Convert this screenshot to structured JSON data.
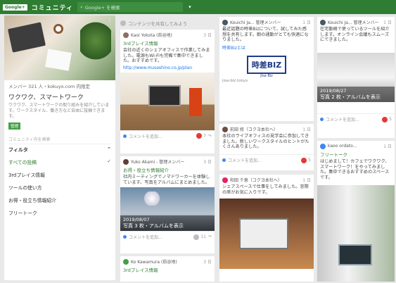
{
  "topbar": {
    "logo": "Google+",
    "app_title": "コミュニティ",
    "search_placeholder": "Google+ を検索",
    "dropdown": "▾"
  },
  "sidebar": {
    "members": "メンバー 321 人・kokuyo.com 内限定",
    "name": "ワクワク、スマートワーク",
    "desc": "ワクワク、スマートワークの取り組みを紹介しています。ワークスタイル、働き方など自由に投稿できます。",
    "manager_badge": "管理",
    "search_placeholder": "コミュニティ内を検索",
    "filter_label": "フィルタ",
    "nav": [
      {
        "label": "すべての投稿",
        "check": "✓"
      },
      {
        "label": "3rdプレイス情報"
      },
      {
        "label": "ツールの使い方"
      },
      {
        "label": "お得・役立ち情報紹介"
      },
      {
        "label": "フリートーク"
      }
    ]
  },
  "share_prompt": "コンテンツを共有してみよう",
  "posts": {
    "p1": {
      "user": "Kaoi Yokota (前谷地)",
      "time": "3 日",
      "title": "3rdプレイス情報",
      "text": "会社の近くのシェアオフィスで作業してみました。電源もWi-Fiも完備で集中できました。おすすめです。",
      "link": "http://www.musashino.co.jp/plan",
      "comment": "コメントを追加...",
      "count": "7"
    },
    "p2": {
      "user": "Yuko Akami - 管理メンバー",
      "time": "3 日",
      "title": "お得・役立ち情報紹介",
      "text": "社内ミーティングでノマドワーカーを体験しています。写真をアルバムにまとめました。",
      "date": "2019/08/07",
      "caption": "写真 3 枚・アルバムを表示",
      "comment": "コメントを追加...",
      "count": "11"
    },
    "p3": {
      "user": "Ko Kawamura (前谷地)",
      "time": "3 日",
      "title": "3rdプレイス情報"
    },
    "p4": {
      "user": "Kouichi Ja... 管理メンバー",
      "time": "1 日",
      "text": "最近話題の時差Bizについて、試してみた感想を共有します。朝の通勤がとても快適になりました。",
      "link_text": "時差Bizとは",
      "logo_text": "時差BIZ",
      "logo_sub": "Jisa Biz",
      "source": "jisa-biz.tokyo",
      "comment": "コメントを追加...",
      "count": "5"
    },
    "p5": {
      "user": "前田 修（コクヨ本社へ）",
      "time": "1 日",
      "text": "本社のライブオフィスの見学会に参加してきました。新しいワークスタイルのヒントがたくさんありました。",
      "link_text": "詳細",
      "comment": "コメントを追加...",
      "count": "5"
    },
    "p6": {
      "user": "和田 千恵（コクヨ本社へ）",
      "time": "1 日",
      "text": "シェアスペースで仕事をしてみました。窓際の席がお気に入りです。"
    },
    "p7": {
      "user": "Kouichi Ja... 管理メンバー",
      "time": "1 日",
      "text": "在宅勤務で使っているツールを紹介します。オンライン会議もスムーズにできました。",
      "date": "2019/08/27",
      "caption": "写真 2 枚・アルバムを表示",
      "comment": "コメントを追加...",
      "count": "5"
    },
    "p8": {
      "user": "kaoo ordato...",
      "time": "1 日",
      "title": "フリートーク",
      "text": "はじめまして！カフェでワクワク、スマートワーク！をやってみました。集中できるおすすめのスペースです。"
    }
  }
}
